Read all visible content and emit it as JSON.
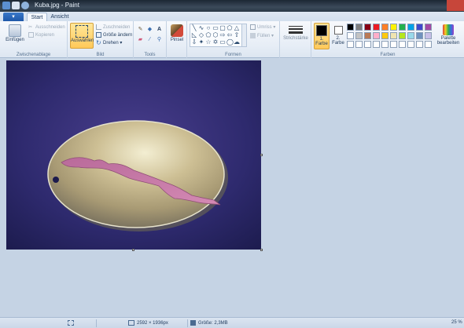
{
  "window": {
    "title": "Kuba.jpg - Paint"
  },
  "tabs": {
    "app_menu": "▾",
    "items": [
      {
        "label": "Start"
      },
      {
        "label": "Ansicht"
      }
    ]
  },
  "ribbon": {
    "clipboard": {
      "label": "Zwischenablage",
      "paste": "Einfügen",
      "cut": "Ausschneiden",
      "copy": "Kopieren"
    },
    "image": {
      "label": "Bild",
      "select": "Auswählen",
      "crop": "Zuschneiden",
      "resize": "Größe ändern",
      "rotate": "Drehen ▾"
    },
    "tools": {
      "label": "Tools"
    },
    "brushes": {
      "label": "Pinsel"
    },
    "shapes": {
      "label": "Formen",
      "outline": "Umriss ▾",
      "fill": "Füllen ▾"
    },
    "stroke": {
      "label": "Strichstärke"
    },
    "colors": {
      "label": "Farben",
      "color1": "1. Farbe",
      "color2": "2. Farbe",
      "edit": "Palette bearbeiten",
      "palette_row1": [
        "#000000",
        "#7f7f7f",
        "#880015",
        "#ed1c24",
        "#ff7f27",
        "#fff200",
        "#22b14c",
        "#00a2e8",
        "#3f48cc",
        "#a349a4"
      ],
      "palette_row2": [
        "#ffffff",
        "#c3c3c3",
        "#b97a57",
        "#ffaec9",
        "#ffc90e",
        "#efe4b0",
        "#b5e61d",
        "#99d9ea",
        "#7092be",
        "#c8bfe7"
      ],
      "palette_row3": [
        "#ffffff",
        "#ffffff",
        "#ffffff",
        "#ffffff",
        "#ffffff",
        "#ffffff",
        "#ffffff",
        "#ffffff",
        "#ffffff",
        "#ffffff"
      ],
      "color1_value": "#000000",
      "color2_value": "#ffffff"
    }
  },
  "status": {
    "dimensions": "2592 × 1936px",
    "size": "Größe: 2,3MB",
    "zoom": "25 %"
  }
}
